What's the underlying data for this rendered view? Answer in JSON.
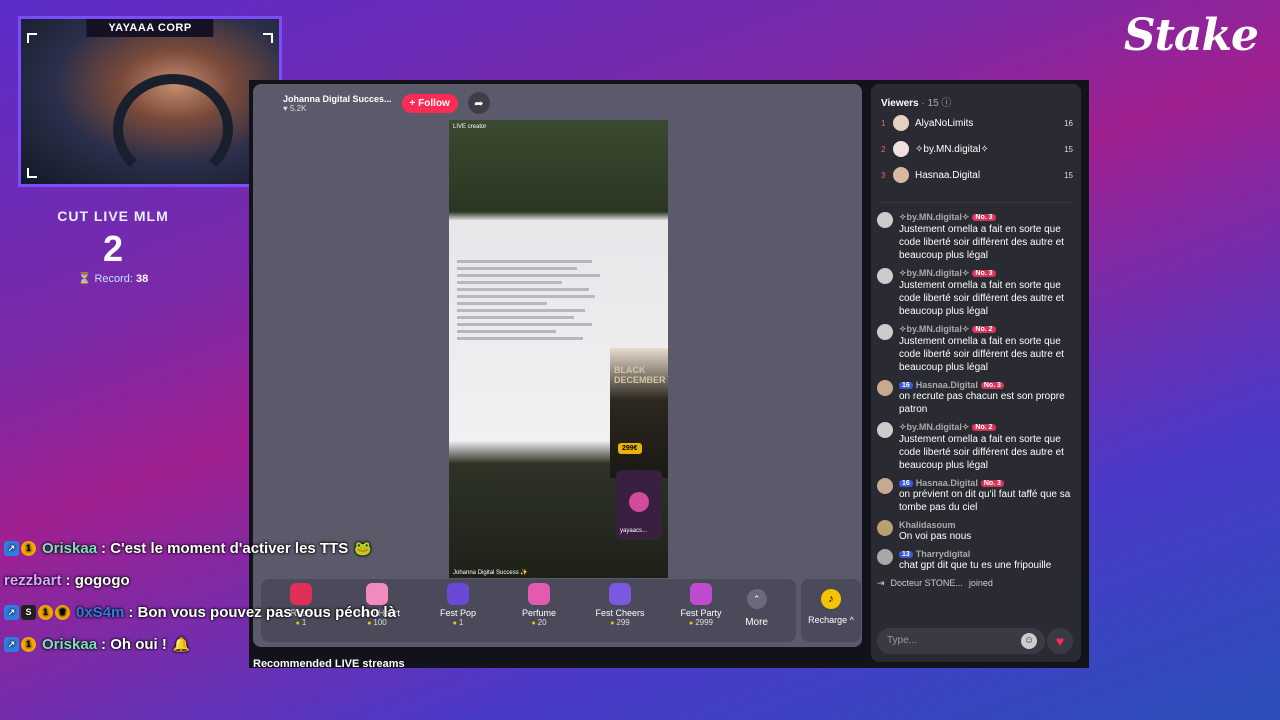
{
  "brand": {
    "logo_text": "Stake"
  },
  "webcam": {
    "title": "YAYAAA CORP"
  },
  "counter": {
    "title": "CUT LIVE MLM",
    "value": "2",
    "record_label": "Record:",
    "record_value": "38"
  },
  "live": {
    "host_name": "Johanna Digital Succes...",
    "host_likes": "♥ 5.2K",
    "follow_label": "+ Follow",
    "video_tag": "LIVE creator",
    "video_caption": "Johanna Digital Success ✨",
    "promo_title": "BLACK DECEMBER",
    "promo_price": "299€",
    "mini_player_name": "yayaacs..."
  },
  "gifts": [
    {
      "name": "Rose",
      "cost": "1",
      "color": "#e0305a"
    },
    {
      "name": "Hand Heart",
      "cost": "100",
      "color": "#f08ac0"
    },
    {
      "name": "Fest Pop",
      "cost": "1",
      "color": "#6a4ad4"
    },
    {
      "name": "Perfume",
      "cost": "20",
      "color": "#e35ab0"
    },
    {
      "name": "Fest Cheers",
      "cost": "299",
      "color": "#7a58e0"
    },
    {
      "name": "Fest Party",
      "cost": "2999",
      "color": "#c04ad0"
    }
  ],
  "more_label": "More",
  "recharge_label": "Recharge ^",
  "recommended_label": "Recommended LIVE streams",
  "viewers": {
    "label": "Viewers",
    "count": "· 15",
    "top": [
      {
        "rank": "1",
        "name": "AlyaNoLimits",
        "score": "16"
      },
      {
        "rank": "2",
        "name": "✧by.MN.digital✧",
        "score": "15"
      },
      {
        "rank": "3",
        "name": "Hasnaa.Digital",
        "score": "15"
      }
    ]
  },
  "chat": [
    {
      "user": "✧by.MN.digital✧",
      "level": "",
      "badge": "No. 3",
      "text": "Justement ornella a fait en sorte que code liberté soir différent des autre et beaucoup plus légal"
    },
    {
      "user": "✧by.MN.digital✧",
      "level": "",
      "badge": "No. 3",
      "text": "Justement ornella a fait en sorte que code liberté soir différent des autre et beaucoup plus légal"
    },
    {
      "user": "✧by.MN.digital✧",
      "level": "",
      "badge": "No. 2",
      "text": "Justement ornella a fait en sorte que code liberté soir différent des autre et beaucoup plus légal"
    },
    {
      "user": "Hasnaa.Digital",
      "level": "16",
      "badge": "No. 3",
      "text": "on recrute pas chacun est son propre patron"
    },
    {
      "user": "✧by.MN.digital✧",
      "level": "",
      "badge": "No. 2",
      "text": "Justement ornella a fait en sorte que code liberté soir différent des autre et beaucoup plus légal"
    },
    {
      "user": "Hasnaa.Digital",
      "level": "16",
      "badge": "No. 3",
      "text": "on prévient on dit qu'il faut taffé que sa tombe pas du ciel"
    },
    {
      "user": "Khalidasoum",
      "level": "",
      "badge": "",
      "text": "On voi pas nous"
    },
    {
      "user": "Tharrydigital",
      "level": "13",
      "badge": "",
      "text": "chat gpt dit que tu es une fripouille"
    }
  ],
  "join": {
    "user": "Docteur STONE...",
    "action": "joined"
  },
  "chat_input_placeholder": "Type...",
  "twitch_chat": [
    {
      "user": "Oriskaa",
      "color": "#7fe0c0",
      "message": ": C'est le moment d'activer les TTS",
      "emote": "🐸"
    },
    {
      "user": "rezzbart",
      "color": "#d8a8ff",
      "message": ": gogogo",
      "emote": ""
    },
    {
      "user": "0xS4m",
      "color": "#2e7de1",
      "message": ": Bon vous pouvez pas vous pécho là",
      "emote": ""
    },
    {
      "user": "Oriskaa",
      "color": "#7fe0c0",
      "message": ": Oh oui !",
      "emote": "🔔"
    }
  ]
}
